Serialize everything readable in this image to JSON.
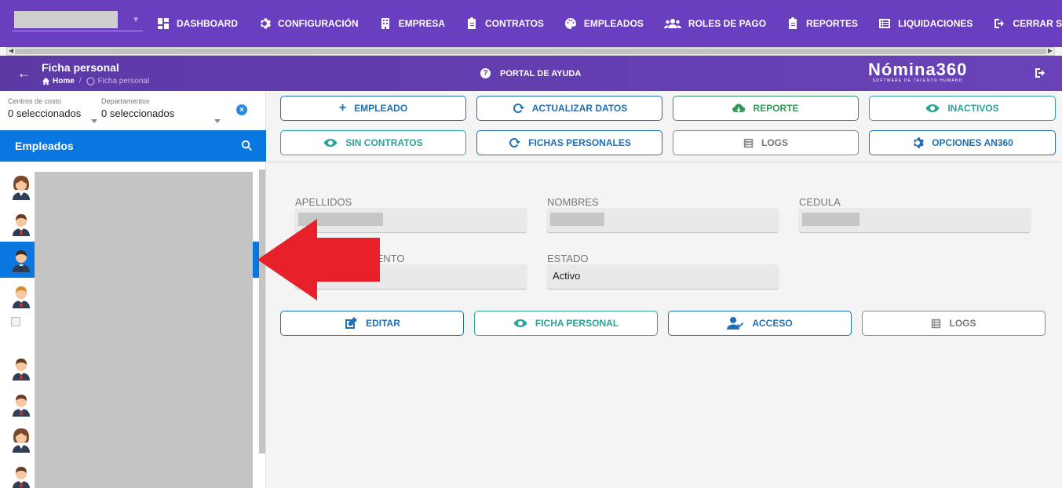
{
  "topnav": {
    "links": [
      {
        "label": "DASHBOARD",
        "icon": "dashboard-icon"
      },
      {
        "label": "CONFIGURACIÓN",
        "icon": "gear-icon"
      },
      {
        "label": "EMPRESA",
        "icon": "building-icon"
      },
      {
        "label": "CONTRATOS",
        "icon": "clipboard-icon"
      },
      {
        "label": "EMPLEADOS",
        "icon": "palette-icon"
      },
      {
        "label": "ROLES DE PAGO",
        "icon": "users-icon"
      },
      {
        "label": "REPORTES",
        "icon": "report-icon"
      },
      {
        "label": "LIQUIDACIONES",
        "icon": "list-icon"
      },
      {
        "label": "CERRAR SESIÓN",
        "icon": "logout-icon"
      }
    ]
  },
  "subheader": {
    "title": "Ficha personal",
    "breadcrumb_home": "Home",
    "breadcrumb_separator": "/",
    "breadcrumb_current": "Ficha personal",
    "help_label": "PORTAL DE AYUDA",
    "logo_name": "Nómina360",
    "logo_tagline": "SOFTWARE DE TALENTO HUMANO"
  },
  "filters": {
    "cost_centers_label": "Centros de costo",
    "cost_centers_value": "0 seleccionados",
    "departments_label": "Departamentos",
    "departments_value": "0 seleccionados"
  },
  "employees": {
    "header": "Empleados"
  },
  "actions": {
    "row1": [
      "EMPLEADO",
      "ACTUALIZAR DATOS",
      "REPORTE",
      "INACTIVOS"
    ],
    "row2": [
      "SIN CONTRATOS",
      "FICHAS PERSONALES",
      "LOGS",
      "OPCIONES AN360"
    ]
  },
  "form": {
    "apellidos_label": "APELLIDOS",
    "nombres_label": "NOMBRES",
    "cedula_label": "CEDULA",
    "nacimiento_label_partial": "IENTO",
    "estado_label": "ESTADO",
    "estado_value": "Activo"
  },
  "record_actions": [
    "EDITAR",
    "FICHA PERSONAL",
    "ACCESO",
    "LOGS"
  ],
  "colors": {
    "nav": "#6a3fbf",
    "accent_blue": "#0a77e0",
    "green": "#2e9a55",
    "teal": "#2aa39a",
    "arrow_red": "#e8202a"
  }
}
